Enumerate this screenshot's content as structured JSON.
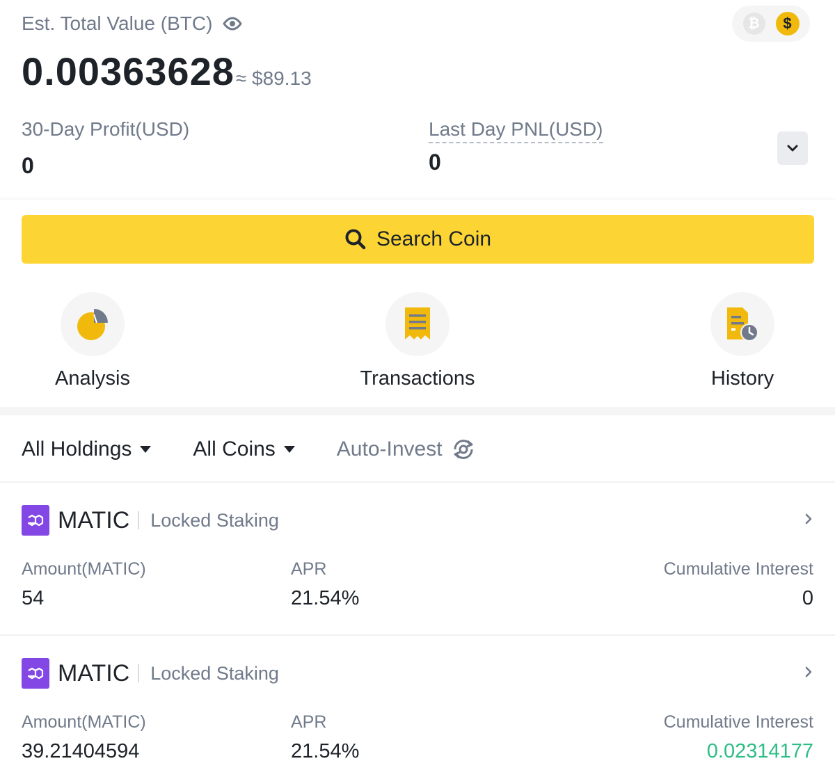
{
  "summary": {
    "est_label": "Est. Total Value (BTC)",
    "total_btc": "0.00363628",
    "approx_usd": "≈ $89.13",
    "currency_options": [
      "₿",
      "$"
    ],
    "selected_currency": "$",
    "profit_label": "30-Day Profit(USD)",
    "profit_value": "0",
    "pnl_label": "Last Day PNL(USD)",
    "pnl_value": "0"
  },
  "search": {
    "label": "Search Coin"
  },
  "shortcuts": [
    {
      "label": "Analysis",
      "icon": "pie-chart-icon"
    },
    {
      "label": "Transactions",
      "icon": "receipt-icon"
    },
    {
      "label": "History",
      "icon": "history-file-icon"
    }
  ],
  "filters": {
    "holdings": "All Holdings",
    "coins": "All Coins",
    "auto_invest": "Auto-Invest"
  },
  "holdings": [
    {
      "coin": "MATIC",
      "product": "Locked Staking",
      "amount_label": "Amount(MATIC)",
      "amount": "54",
      "apr_label": "APR",
      "apr": "21.54%",
      "interest_label": "Cumulative Interest",
      "interest": "0"
    },
    {
      "coin": "MATIC",
      "product": "Locked Staking",
      "amount_label": "Amount(MATIC)",
      "amount": "39.21404594",
      "apr_label": "APR",
      "apr": "21.54%",
      "interest_label": "Cumulative Interest",
      "interest": "0.02314177"
    }
  ],
  "colors": {
    "accent_yellow": "#fcd535",
    "brand_gold": "#f0b90b",
    "matic_purple": "#8247e5",
    "positive_green": "#2ebd85",
    "secondary_text": "#707a8a"
  }
}
